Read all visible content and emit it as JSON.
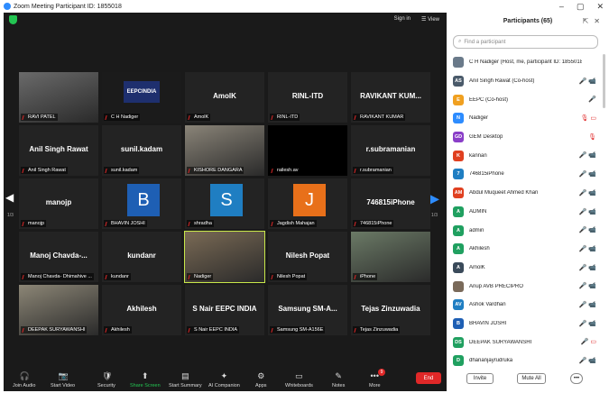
{
  "window": {
    "title": "Zoom Meeting Participant ID: 1855018",
    "minimize": "–",
    "maximize": "▢",
    "close": "✕"
  },
  "topbar": {
    "signin": "Sign in",
    "view": "☰ View"
  },
  "nav": {
    "left_arrow": "◀",
    "right_arrow": "▶",
    "page_left": "1/3",
    "page_right": "1/3"
  },
  "tiles": [
    {
      "center": "",
      "label": "RAVI PATEL",
      "kind": "video",
      "color": "#6a6a6a"
    },
    {
      "center": "EEPCINDIA",
      "label": "C H Nadiger",
      "kind": "logo",
      "color": "#1e2f6e"
    },
    {
      "center": "AmolK",
      "label": "AmolK",
      "kind": "name"
    },
    {
      "center": "RINL-ITD",
      "label": "RINL-ITD",
      "kind": "name"
    },
    {
      "center": "RAVIKANT KUM...",
      "label": "RAVIKANT KUMAR",
      "kind": "name"
    },
    {
      "center": "Anil Singh Rawat",
      "label": "Anil Singh Rawat",
      "kind": "name"
    },
    {
      "center": "sunil.kadam",
      "label": "sunil.kadam",
      "kind": "name"
    },
    {
      "center": "",
      "label": "KISHORE DANGARA",
      "kind": "video",
      "color": "#8a8478"
    },
    {
      "center": "",
      "label": "railesh.av",
      "kind": "black"
    },
    {
      "center": "r.subramanian",
      "label": "r.subramanian",
      "kind": "name"
    },
    {
      "center": "manojp",
      "label": "manojp",
      "kind": "name"
    },
    {
      "center": "B",
      "label": "BHAVIN JOSHI",
      "kind": "avatar",
      "color": "#1e5fb4"
    },
    {
      "center": "S",
      "label": "shradha",
      "kind": "avatar",
      "color": "#1f7ec2"
    },
    {
      "center": "J",
      "label": "Jagdish Mahajan",
      "kind": "avatar",
      "color": "#e8701a"
    },
    {
      "center": "746815iPhone",
      "label": "746815iPhone",
      "kind": "name"
    },
    {
      "center": "Manoj Chavda-...",
      "label": "Manoj Chavda- Dhimahive ...",
      "kind": "name"
    },
    {
      "center": "kundanr",
      "label": "kundanr",
      "kind": "name"
    },
    {
      "center": "",
      "label": "Nadiger",
      "kind": "video-active",
      "color": "#7a6a55"
    },
    {
      "center": "Nilesh Popat",
      "label": "Nilesh Popat",
      "kind": "name"
    },
    {
      "center": "",
      "label": "iPhone",
      "kind": "video",
      "color": "#6b7a66"
    },
    {
      "center": "",
      "label": "DEEPAK SURYAWANSHI",
      "kind": "video",
      "color": "#8c8676"
    },
    {
      "center": "Akhilesh",
      "label": "Akhilesh",
      "kind": "name"
    },
    {
      "center": "S Nair EEPC INDIA",
      "label": "S Nair EEPC INDIA",
      "kind": "name"
    },
    {
      "center": "Samsung SM-A...",
      "label": "Samsung SM-A156E",
      "kind": "name"
    },
    {
      "center": "Tejas Zinzuwadia",
      "label": "Tejas Zinzuwadia",
      "kind": "name"
    }
  ],
  "toolbar": {
    "items": [
      {
        "label": "Join Audio",
        "icon": "🎧"
      },
      {
        "label": "Start Video",
        "icon": "📷"
      },
      {
        "label": "Security",
        "icon": "🛡"
      },
      {
        "label": "Share Screen",
        "icon": "⬆"
      },
      {
        "label": "Start Summary",
        "icon": "▤"
      },
      {
        "label": "AI Companion",
        "icon": "✦"
      },
      {
        "label": "Apps",
        "icon": "⚙"
      },
      {
        "label": "Whiteboards",
        "icon": "▭"
      },
      {
        "label": "Notes",
        "icon": "✎"
      },
      {
        "label": "More",
        "icon": "•••"
      }
    ],
    "more_badge": "9",
    "end": "End"
  },
  "panel": {
    "title": "Participants (65)",
    "popout": "⇱",
    "close": "✕",
    "search_placeholder": "Find a participant",
    "participants": [
      {
        "initials": "",
        "name": "C H Nadiger (Host, me, participant ID: 1855018)",
        "color": "#6a7a8a",
        "icons": ""
      },
      {
        "initials": "AS",
        "name": "Anil Singh Rawat (Co-host)",
        "color": "#4a5a6a",
        "icons": "🎤 📹"
      },
      {
        "initials": "E",
        "name": "EEPC (Co-host)",
        "color": "#f0a020",
        "icons": "🎤"
      },
      {
        "initials": "N",
        "name": "Nadiger",
        "color": "#2d8cff",
        "icons": "🎙 ▭"
      },
      {
        "initials": "GD",
        "name": "GEM Desktop",
        "color": "#8a3ec8",
        "icons": "🎙"
      },
      {
        "initials": "K",
        "name": "kannan",
        "color": "#e04020",
        "icons": "🎤 📹"
      },
      {
        "initials": "7",
        "name": "746815iPhone",
        "color": "#1f7ec2",
        "icons": "🎤 📹"
      },
      {
        "initials": "AM",
        "name": "Abdul Muqueet Ahmed Khan",
        "color": "#e04020",
        "icons": "🎤 📹"
      },
      {
        "initials": "A",
        "name": "ADMIN",
        "color": "#20a060",
        "icons": "🎤 📹"
      },
      {
        "initials": "A",
        "name": "admin",
        "color": "#20a060",
        "icons": "🎤 📹"
      },
      {
        "initials": "A",
        "name": "Akhilesh",
        "color": "#20a060",
        "icons": "🎤 📹"
      },
      {
        "initials": "A",
        "name": "AmolK",
        "color": "#3a4a5a",
        "icons": "🎤 📹"
      },
      {
        "initials": "",
        "name": "Anup AVB PRECIPRO",
        "color": "#7a6a5a",
        "icons": "🎤 📹"
      },
      {
        "initials": "AV",
        "name": "Ashok Vardhan",
        "color": "#1f7ec2",
        "icons": "🎤 📹"
      },
      {
        "initials": "B",
        "name": "BHAVIN JOSHI",
        "color": "#1e5fb4",
        "icons": "🎤 📹"
      },
      {
        "initials": "DS",
        "name": "DEEPAK SURYAWANSHI",
        "color": "#20a060",
        "icons": "🎤 ▭"
      },
      {
        "initials": "D",
        "name": "dhananjayrudruka",
        "color": "#20a060",
        "icons": "🎤 📹"
      }
    ],
    "invite": "Invite",
    "mute_all": "Mute All",
    "more": "•••"
  }
}
